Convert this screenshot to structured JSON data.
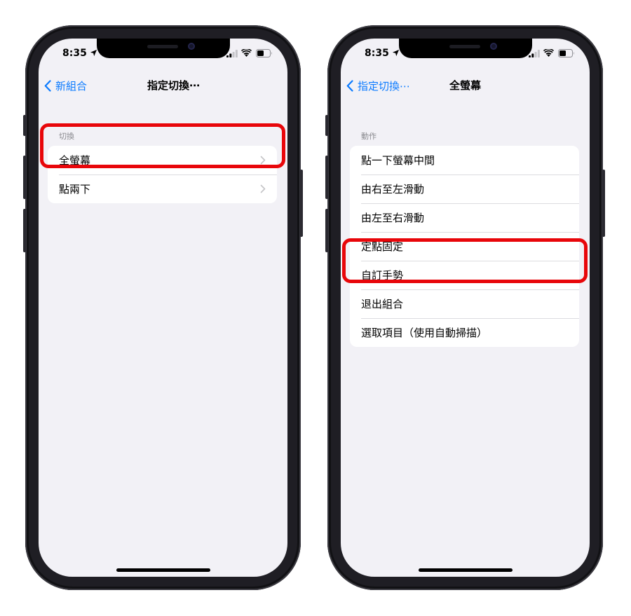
{
  "left_phone": {
    "status_time": "8:35",
    "nav": {
      "back_label": "新組合",
      "title": "指定切換⋯"
    },
    "section_header": "切換",
    "items": [
      {
        "label": "全螢幕",
        "chevron": "chevron-right-icon",
        "highlighted": true
      },
      {
        "label": "點兩下",
        "chevron": "chevron-right-icon",
        "highlighted": false
      }
    ]
  },
  "right_phone": {
    "status_time": "8:35",
    "nav": {
      "back_label": "指定切換⋯",
      "title": "全螢幕"
    },
    "section_header": "動作",
    "items": [
      {
        "label": "點一下螢幕中間"
      },
      {
        "label": "由右至左滑動"
      },
      {
        "label": "由左至右滑動"
      },
      {
        "label": "定點固定"
      },
      {
        "label": "自訂手勢",
        "highlighted": true
      },
      {
        "label": "退出組合"
      },
      {
        "label": "選取項目（使用自動掃描）"
      }
    ]
  },
  "colors": {
    "accent": "#0a7aff",
    "highlight": "#e8060a",
    "background": "#f2f1f6"
  }
}
